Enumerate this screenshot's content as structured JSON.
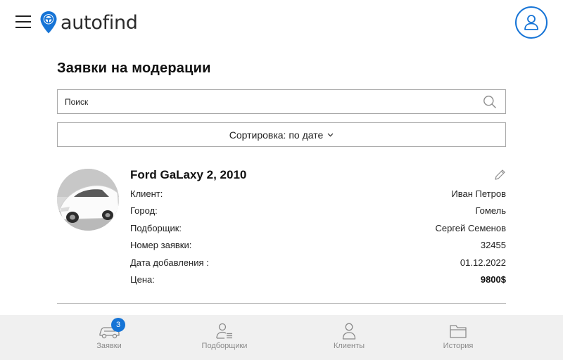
{
  "app": {
    "brand": "autofind",
    "accent_color": "#1674d6"
  },
  "header": {
    "menu_icon": "hamburger-icon",
    "logo_icon": "location-pin-steering-wheel-icon",
    "profile_icon": "user-icon"
  },
  "page": {
    "title": "Заявки на модерации"
  },
  "search": {
    "placeholder": "Поиск",
    "icon": "search-icon"
  },
  "sort": {
    "label": "Сортировка: по дате",
    "icon": "chevron-down-icon"
  },
  "requests": [
    {
      "title": "Ford GaLaxy 2, 2010",
      "photo": "white-car-photo",
      "fields": [
        {
          "label": "Клиент:",
          "value": "Иван Петров"
        },
        {
          "label": "Город:",
          "value": "Гомель"
        },
        {
          "label": "Подборщик:",
          "value": "Сергей Семенов"
        },
        {
          "label": "Номер заявки:",
          "value": "32455"
        },
        {
          "label": "Дата добавления :",
          "value": "01.12.2022"
        },
        {
          "label": "Цена:",
          "value": "9800$"
        }
      ]
    }
  ],
  "bottom_nav": [
    {
      "label": "Заявки",
      "icon": "car-icon",
      "badge": "3"
    },
    {
      "label": "Подборщики",
      "icon": "user-list-icon"
    },
    {
      "label": "Клиенты",
      "icon": "user-icon"
    },
    {
      "label": "История",
      "icon": "folder-icon"
    }
  ]
}
